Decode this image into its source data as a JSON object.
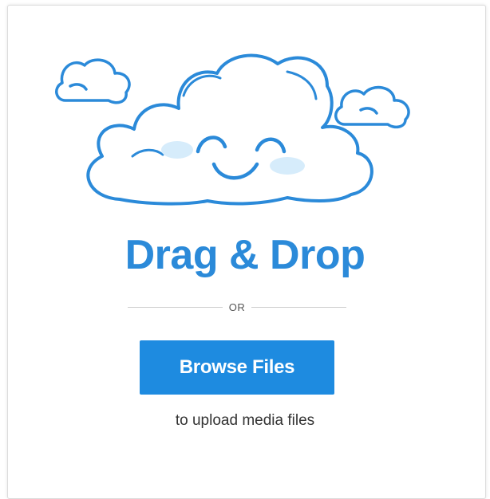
{
  "dropzone": {
    "title": "Drag & Drop",
    "divider_text": "OR",
    "browse_label": "Browse Files",
    "subtitle": "to upload media files"
  },
  "icons": {
    "illustration": "smiling-cloud-icon",
    "small_left": "cloud-icon",
    "small_right": "cloud-icon"
  },
  "colors": {
    "accent": "#2b8ad9",
    "button": "#1e8be0",
    "cheek": "#d6ecfb"
  }
}
